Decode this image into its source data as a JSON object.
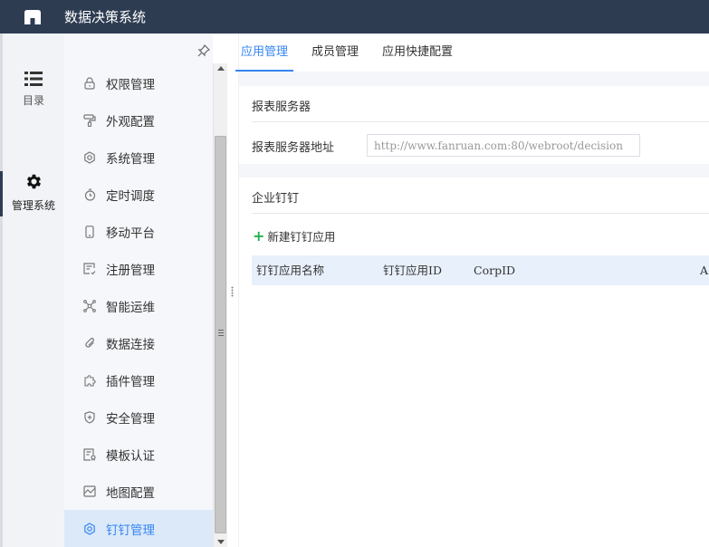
{
  "app": {
    "title": "数据决策系统"
  },
  "rail": {
    "items": [
      {
        "label": "目录",
        "icon": "list-icon"
      },
      {
        "label": "管理系统",
        "icon": "gear-icon"
      }
    ]
  },
  "sidebar": {
    "items": [
      {
        "label": "权限管理",
        "icon": "lock-icon"
      },
      {
        "label": "外观配置",
        "icon": "paint-roller-icon"
      },
      {
        "label": "系统管理",
        "icon": "settings-icon"
      },
      {
        "label": "定时调度",
        "icon": "stopwatch-icon"
      },
      {
        "label": "移动平台",
        "icon": "mobile-icon"
      },
      {
        "label": "注册管理",
        "icon": "register-icon"
      },
      {
        "label": "智能运维",
        "icon": "network-icon"
      },
      {
        "label": "数据连接",
        "icon": "paperclip-icon"
      },
      {
        "label": "插件管理",
        "icon": "puzzle-icon"
      },
      {
        "label": "安全管理",
        "icon": "shield-icon"
      },
      {
        "label": "模板认证",
        "icon": "certificate-icon"
      },
      {
        "label": "地图配置",
        "icon": "map-icon"
      },
      {
        "label": "钉钉管理",
        "icon": "dingtalk-settings-icon"
      }
    ],
    "active_index": 12
  },
  "tabs": [
    {
      "label": "应用管理"
    },
    {
      "label": "成员管理"
    },
    {
      "label": "应用快捷配置"
    }
  ],
  "report_server": {
    "title": "报表服务器",
    "address_label": "报表服务器地址",
    "address_value": "http://www.fanruan.com:80/webroot/decision"
  },
  "dingtalk": {
    "title": "企业钉钉",
    "add_label": "新建钉钉应用",
    "columns": [
      "钉钉应用名称",
      "钉钉应用ID",
      "CorpID",
      "A"
    ]
  },
  "colors": {
    "topbar": "#2e3c52",
    "accent": "#3685f2",
    "add_green": "#22b14c"
  }
}
